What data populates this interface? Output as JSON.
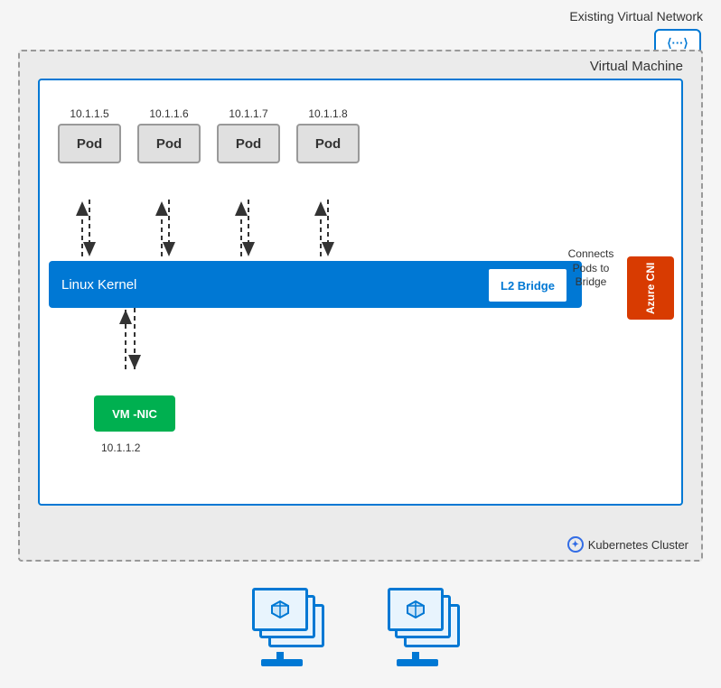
{
  "diagram": {
    "title": "Existing Virtual Network",
    "network_icon_dots": "⟨···⟩",
    "vm_label": "Virtual Machine",
    "k8s_label": "Kubernetes Cluster",
    "pods": [
      {
        "ip": "10.1.1.5",
        "label": "Pod"
      },
      {
        "ip": "10.1.1.6",
        "label": "Pod"
      },
      {
        "ip": "10.1.1.7",
        "label": "Pod"
      },
      {
        "ip": "10.1.1.8",
        "label": "Pod"
      }
    ],
    "kernel_label": "Linux Kernel",
    "l2_bridge_label": "L2 Bridge",
    "azure_cni_label": "Azure CNI",
    "connects_label": "Connects Pods to Bridge",
    "vm_nic_label": "VM -NIC",
    "vm_nic_ip": "10.1.1.2"
  }
}
